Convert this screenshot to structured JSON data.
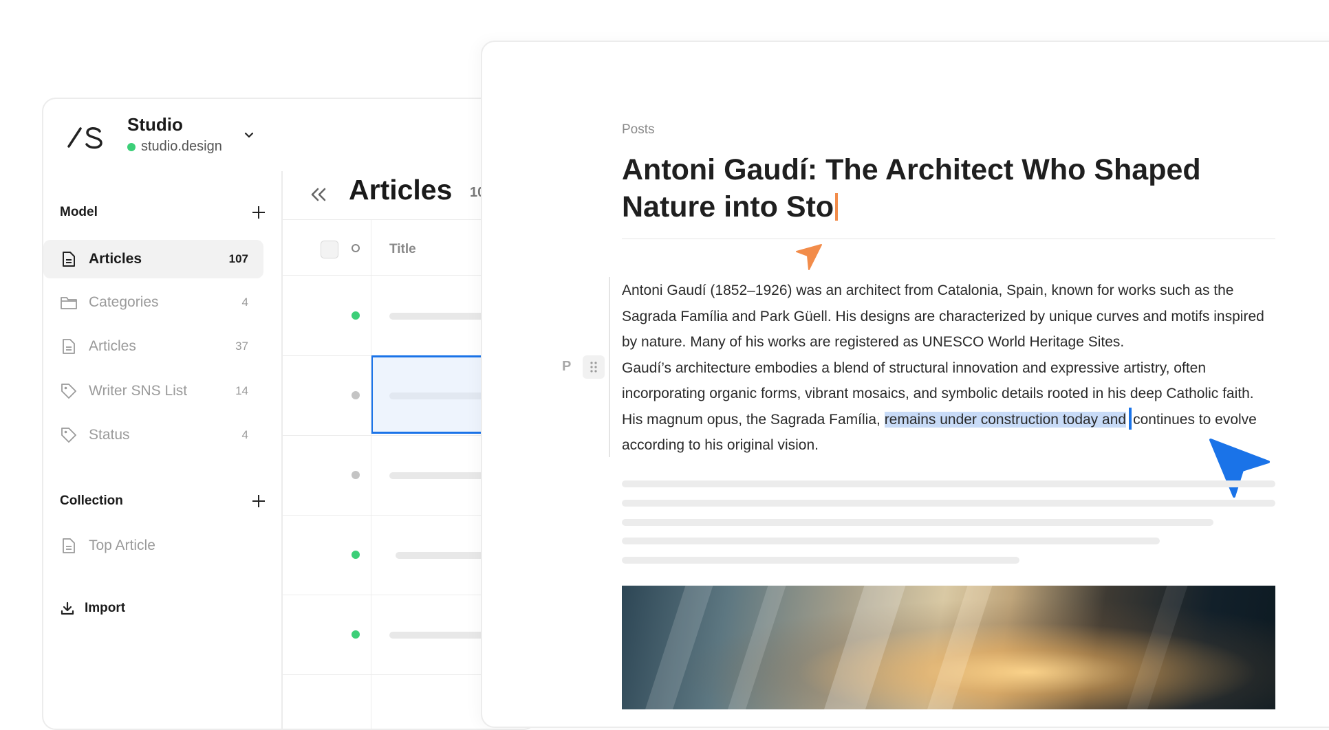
{
  "project": {
    "name": "Studio",
    "domain": "studio.design",
    "status_color": "#3ccf78"
  },
  "sidebar": {
    "model_section": {
      "title": "Model",
      "items": [
        {
          "label": "Articles",
          "count": "107",
          "icon": "document-icon",
          "active": true
        },
        {
          "label": "Categories",
          "count": "4",
          "icon": "folder-icon",
          "active": false
        },
        {
          "label": "Articles",
          "count": "37",
          "icon": "document-icon",
          "active": false
        },
        {
          "label": "Writer SNS List",
          "count": "14",
          "icon": "tag-icon",
          "active": false
        },
        {
          "label": "Status",
          "count": "4",
          "icon": "tag-icon",
          "active": false
        }
      ]
    },
    "collection_section": {
      "title": "Collection",
      "items": [
        {
          "label": "Top Article",
          "icon": "document-icon"
        }
      ]
    },
    "import_label": "Import"
  },
  "list": {
    "title": "Articles",
    "count_partial": "10",
    "column_title": "Title",
    "rows": [
      {
        "status": "published",
        "status_color": "#3ccf78",
        "selected": false
      },
      {
        "status": "draft",
        "status_color": "#c4c4c4",
        "selected": true
      },
      {
        "status": "draft",
        "status_color": "#c4c4c4",
        "selected": false
      },
      {
        "status": "published",
        "status_color": "#3ccf78",
        "selected": false
      },
      {
        "status": "published",
        "status_color": "#3ccf78",
        "selected": false
      }
    ]
  },
  "editor": {
    "breadcrumb": "Posts",
    "title": "Antoni Gaudí: The Architect Who Shaped Nature into Sto",
    "block_type": "P",
    "paragraph1": "Antoni Gaudí (1852–1926) was an architect from Catalonia, Spain, known for works such as the Sagrada Família and Park Güell. His designs are characterized by unique curves and motifs inspired by nature. Many of his works are registered as UNESCO World Heritage Sites.",
    "paragraph2_before": "Gaudí’s architecture embodies a blend of structural innovation and expressive artistry, often incorporating organic forms, vibrant mosaics, and symbolic details rooted in his deep Catholic faith. His magnum opus, the Sagrada Família, ",
    "paragraph2_selected": "remains under construction today and",
    "paragraph2_after": "continues to evolve according to his original vision.",
    "cursor_colors": {
      "collaborator": "#f28c4a",
      "self": "#1a73e8"
    }
  },
  "colors": {
    "accent": "#1a73e8",
    "selection": "#c8dbf7",
    "published": "#3ccf78"
  }
}
